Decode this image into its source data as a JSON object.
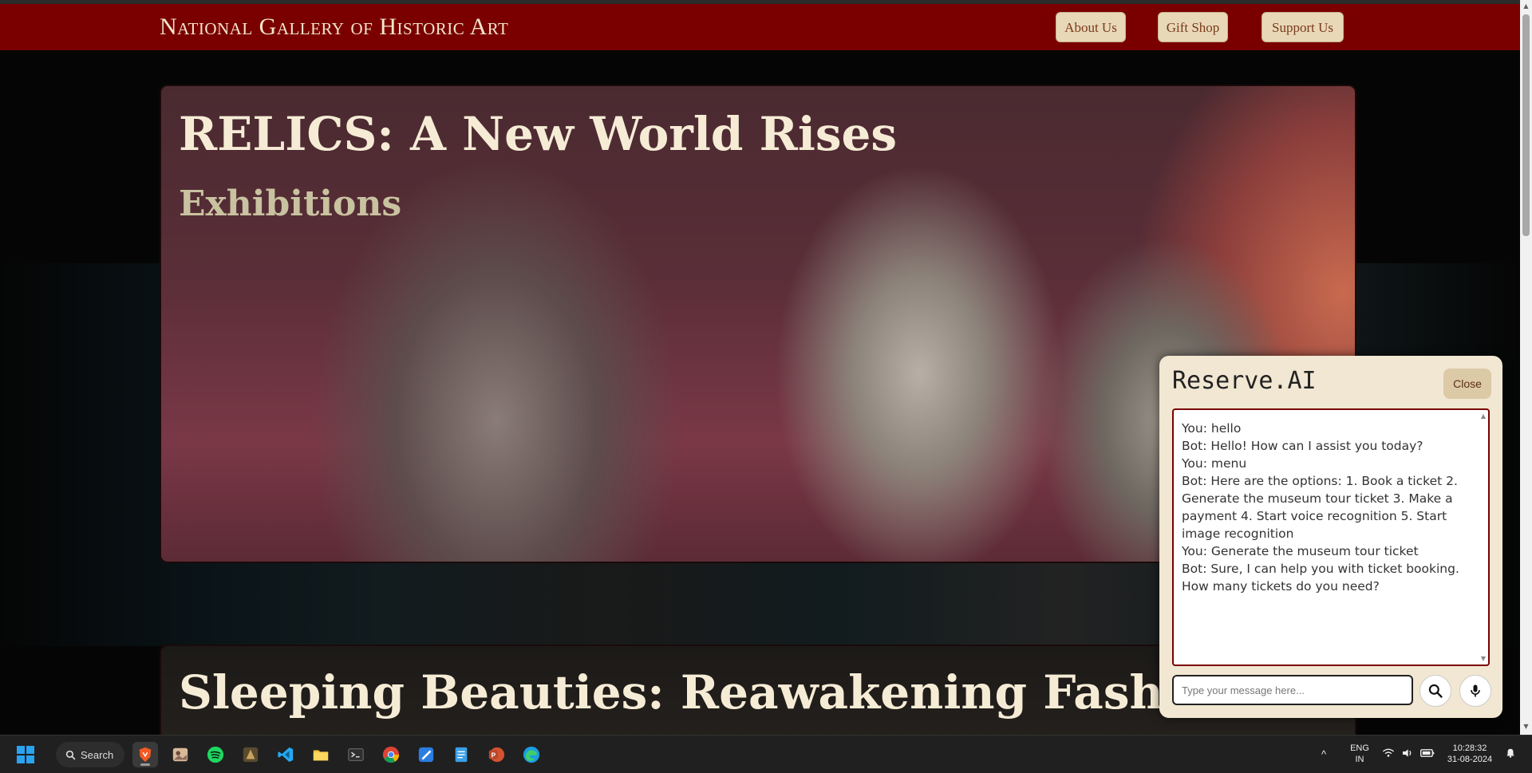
{
  "header": {
    "site_title": "National Gallery of Historic Art",
    "nav": [
      "About Us",
      "Gift Shop",
      "Support Us"
    ]
  },
  "exhibitions": [
    {
      "title": "RELICS: A New World Rises",
      "subtitle": "Exhibitions"
    },
    {
      "title": "Sleeping Beauties: Reawakening Fashion"
    }
  ],
  "chat": {
    "title": "Reserve.AI",
    "close_label": "Close",
    "messages": [
      "You: hello",
      "Bot: Hello! How can I assist you today?",
      "You: menu",
      "Bot: Here are the options: 1. Book a ticket 2. Generate the museum tour ticket 3. Make a payment 4. Start voice recognition 5. Start image recognition",
      "You: Generate the museum tour ticket",
      "Bot: Sure, I can help you with ticket booking. How many tickets do you need?"
    ],
    "input_placeholder": "Type your message here...",
    "input_value": "",
    "search_icon": "search-icon",
    "mic_icon": "microphone-icon"
  },
  "taskbar": {
    "search_label": "Search",
    "apps": [
      "windows-start",
      "brave",
      "photos",
      "spotify",
      "game",
      "vscode",
      "file-explorer",
      "terminal",
      "chrome",
      "paint",
      "notepad",
      "powerpoint",
      "edge"
    ],
    "language": [
      "ENG",
      "IN"
    ],
    "time": "10:28:32",
    "date": "31-08-2024"
  },
  "colors": {
    "header_bg": "#7a0000",
    "chat_bg": "#f1e7d2",
    "accent": "#7a0000"
  }
}
